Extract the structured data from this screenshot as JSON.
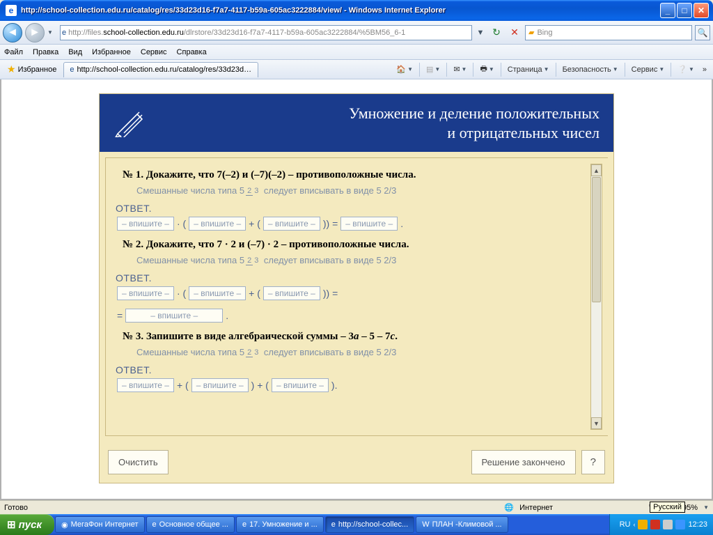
{
  "window": {
    "title": "http://school-collection.edu.ru/catalog/res/33d23d16-f7a7-4117-b59a-605ac3222884/view/ - Windows Internet Explorer"
  },
  "address": {
    "prefix": "http://files.",
    "host": "school-collection.edu.ru",
    "path": "/dlrstore/33d23d16-f7a7-4117-b59a-605ac3222884/%5BM56_6-1"
  },
  "search": {
    "provider": "Bing"
  },
  "menu": {
    "file": "Файл",
    "edit": "Правка",
    "view": "Вид",
    "fav": "Избранное",
    "tools": "Сервис",
    "help": "Справка"
  },
  "favbar": {
    "label": "Избранное",
    "tab": "http://school-collection.edu.ru/catalog/res/33d23d16..."
  },
  "cmd": {
    "page": "Страница",
    "safety": "Безопасность",
    "service": "Сервис"
  },
  "lesson": {
    "title1": "Умножение и деление положительных",
    "title2": "и отрицательных чисел",
    "hint_pre": "Смешанные числа типа 5",
    "hint_num": "2",
    "hint_den": "3",
    "hint_post": " следует вписывать в виде  5 2/3",
    "answer": "ОТВЕТ.",
    "placeholder": "– впишите –",
    "p1": "№ 1. Докажите, что 7(–2) и (–7)(–2) – противоположные числа.",
    "p2": "№ 2. Докажите, что 7 · 2 и (–7) · 2 – противоположные числа.",
    "p3_a": "№ 3. Запишите в виде алгебраической суммы – 3",
    "p3_b": "a",
    "p3_c": " – 5 – 7",
    "p3_d": "c",
    "p3_e": ".",
    "clear": "Очистить",
    "done": "Решение закончено",
    "help": "?"
  },
  "status": {
    "ready": "Готово",
    "zone": "Интернет",
    "zoom": "95%"
  },
  "lang_tooltip": "Русский",
  "taskbar": {
    "start": "пуск",
    "items": [
      "МегаФон Интернет",
      "Основное общее ...",
      "17. Умножение и ...",
      "http://school-collec...",
      "ПЛАН -Климовой ..."
    ],
    "lang": "RU",
    "clock": "12:23"
  }
}
